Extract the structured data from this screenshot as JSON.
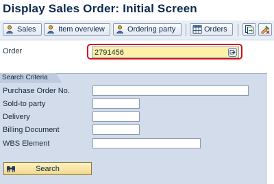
{
  "title": "Display Sales Order: Initial Screen",
  "toolbar": {
    "sales_label": "Sales",
    "item_overview_label": "Item overview",
    "ordering_party_label": "Ordering party",
    "orders_label": "Orders"
  },
  "order": {
    "label": "Order",
    "value": "2791456"
  },
  "search_criteria": {
    "title": "Search Criteria",
    "fields": [
      {
        "label": "Purchase Order No.",
        "value": ""
      },
      {
        "label": "Sold-to party",
        "value": ""
      },
      {
        "label": "Delivery",
        "value": ""
      },
      {
        "label": "Billing Document",
        "value": ""
      },
      {
        "label": "WBS Element",
        "value": ""
      }
    ],
    "search_label": "Search"
  },
  "colors": {
    "accent_highlight": "#d4101a",
    "required_field": "#fff0a8",
    "group_background": "#d2dcea"
  },
  "icons": [
    "person-magnifier-icon",
    "table-icon",
    "other-document-icon",
    "display-change-icon",
    "binoculars-icon",
    "value-help-icon"
  ]
}
